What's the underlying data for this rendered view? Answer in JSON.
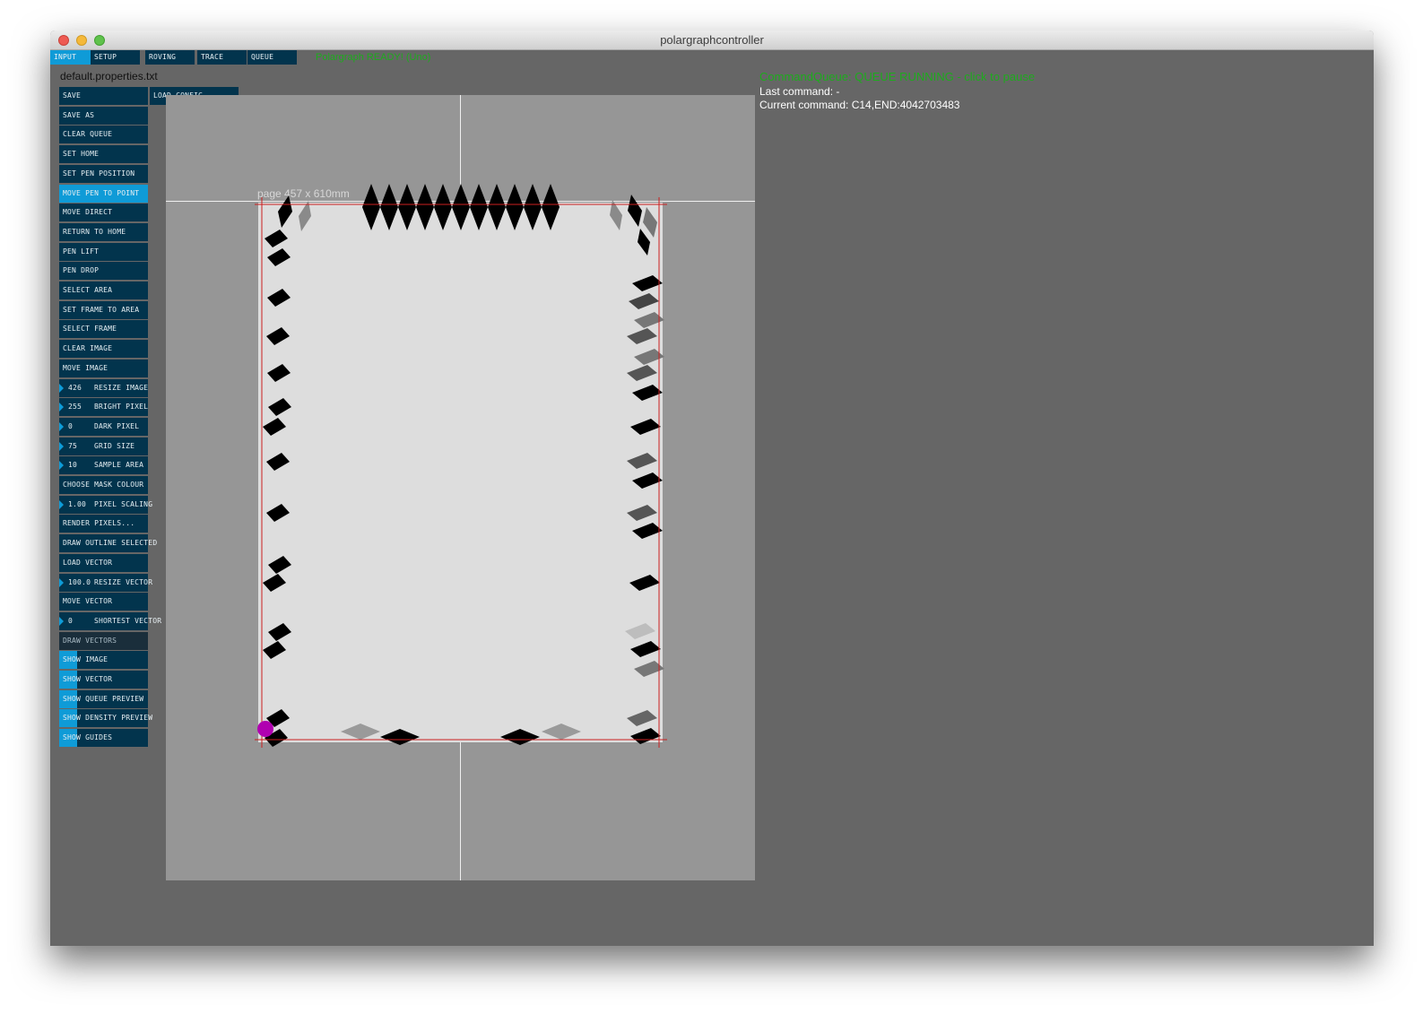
{
  "window": {
    "title": "polargraphcontroller"
  },
  "tabs": [
    {
      "label": "INPUT",
      "active": true
    },
    {
      "label": "SETUP",
      "active": false
    },
    {
      "label": "ROVING",
      "active": false
    },
    {
      "label": "TRACE",
      "active": false
    },
    {
      "label": "QUEUE",
      "active": false
    }
  ],
  "status": {
    "text": "Polargraph READY! (Uno)",
    "color": "#1dab1d"
  },
  "properties_file": "default.properties.txt",
  "load_config_label": "LOAD CONFIG",
  "buttons": [
    {
      "label": "SAVE"
    },
    {
      "label": "SAVE AS"
    },
    {
      "label": "CLEAR QUEUE"
    },
    {
      "label": "SET HOME"
    },
    {
      "label": "SET PEN POSITION"
    },
    {
      "label": "MOVE PEN TO POINT",
      "active": true
    },
    {
      "label": "MOVE DIRECT"
    },
    {
      "label": "RETURN TO HOME"
    },
    {
      "label": "PEN LIFT"
    },
    {
      "label": "PEN DROP"
    },
    {
      "label": "SELECT AREA"
    },
    {
      "label": "SET FRAME TO AREA"
    },
    {
      "label": "SELECT FRAME"
    },
    {
      "label": "CLEAR IMAGE"
    },
    {
      "label": "MOVE IMAGE"
    },
    {
      "label": "RESIZE IMAGE",
      "value": "426"
    },
    {
      "label": "BRIGHT PIXEL",
      "value": "255"
    },
    {
      "label": "DARK PIXEL",
      "value": "0"
    },
    {
      "label": "GRID SIZE",
      "value": "75"
    },
    {
      "label": "SAMPLE AREA",
      "value": "10"
    },
    {
      "label": "CHOOSE MASK COLOUR"
    },
    {
      "label": "PIXEL SCALING",
      "value": "1.00"
    },
    {
      "label": "RENDER PIXELS..."
    },
    {
      "label": "DRAW OUTLINE SELECTED"
    },
    {
      "label": "LOAD VECTOR"
    },
    {
      "label": "RESIZE VECTOR",
      "value": "100.0"
    },
    {
      "label": "MOVE VECTOR"
    },
    {
      "label": "SHORTEST VECTOR",
      "value": "0"
    },
    {
      "label": "DRAW VECTORS",
      "disabled": true
    },
    {
      "label": "SHOW IMAGE",
      "toggle": true
    },
    {
      "label": "SHOW VECTOR",
      "toggle": true
    },
    {
      "label": "SHOW QUEUE PREVIEW",
      "toggle": true
    },
    {
      "label": "SHOW DENSITY PREVIEW",
      "toggle": true
    },
    {
      "label": "SHOW GUIDES",
      "toggle": true
    }
  ],
  "page_label": "page 457 x 610mm",
  "queue": {
    "status": "CommandQueue: QUEUE RUNNING - click to pause",
    "last_command": "Last command: -",
    "current_command": "Current command: C14,END:4042703483"
  },
  "colors": {
    "button_bg": "#02344d",
    "button_active": "#0f9bd7",
    "frame_red": "#cc1f1f",
    "pen_marker": "#b000b0"
  }
}
